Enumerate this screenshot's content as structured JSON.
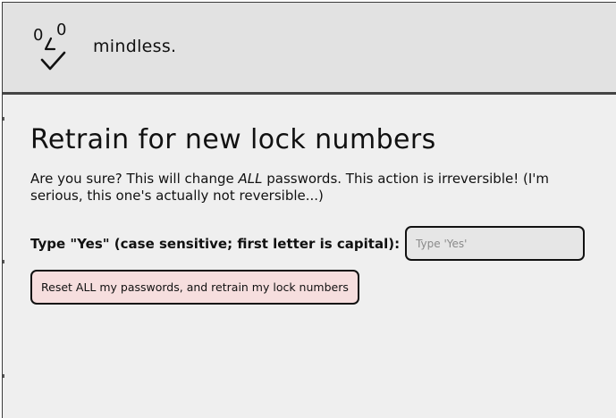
{
  "header": {
    "brand_name": "mindless.",
    "logo_icon": "lock-dial-check-logo-icon"
  },
  "main": {
    "title": "Retrain for new lock numbers",
    "warning": {
      "before_emphasis": "Are you sure? This will change ",
      "emphasis": "ALL",
      "after_emphasis": " passwords. This action is irreversible! (I'm serious, this one's actually not reversible...)"
    },
    "confirm": {
      "label": "Type \"Yes\" (case sensitive; first letter is capital):",
      "value": "",
      "placeholder": "Type 'Yes'"
    },
    "reset_button_label": "Reset ALL my passwords, and retrain my lock numbers"
  },
  "colors": {
    "page_background": "#efefef",
    "header_background": "#e2e2e2",
    "danger_button_background": "#f6dede",
    "border": "#111111"
  }
}
